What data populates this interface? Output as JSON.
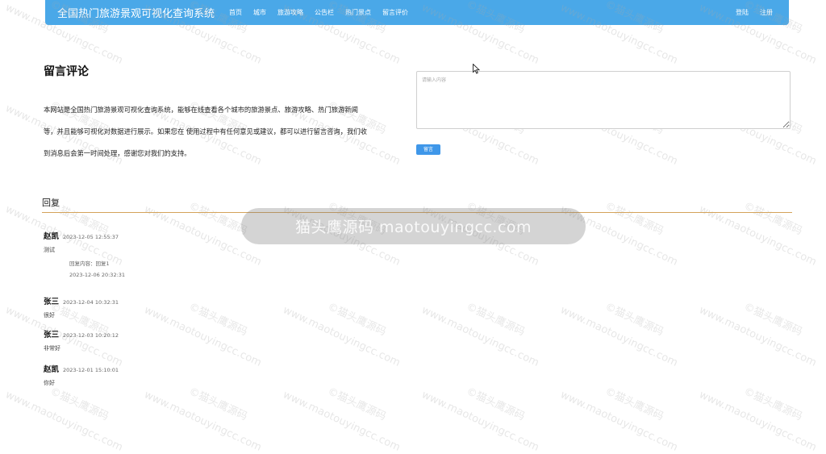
{
  "header": {
    "brand": "全国热门旅游景观可视化查询系统",
    "nav": [
      "首页",
      "城市",
      "旅游攻略",
      "公告栏",
      "热门景点",
      "留言评价"
    ],
    "login": "登陆",
    "register": "注册"
  },
  "intro": {
    "title": "留言评论",
    "text": "本网站是全国热门旅游景观可视化查询系统，能够在线查看各个城市的旅游景点、旅游攻略、热门旅游新闻等，并且能够可视化对数据进行展示。如果您在 使用过程中有任何意见或建议，都可以进行留言咨询，我们收到消息后会第一时间处理，感谢您对我们的支持。"
  },
  "form": {
    "placeholder": "请输入内容",
    "submit_label": "留言"
  },
  "replies": {
    "heading": "回复",
    "comments": [
      {
        "author": "赵凯",
        "time": "2023-12-05 12:55:37",
        "content": "测试",
        "reply_content": "回复内容：回复1",
        "reply_time": "2023-12-06 20:32:31"
      },
      {
        "author": "张三",
        "time": "2023-12-04 10:32:31",
        "content": "很好"
      },
      {
        "author": "张三",
        "time": "2023-12-03 10:20:12",
        "content": "非常好"
      },
      {
        "author": "赵凯",
        "time": "2023-12-01 15:10:01",
        "content": "你好"
      }
    ]
  },
  "watermark": {
    "site": "www.maotouyingcc.com",
    "brand": "©猫头鹰源码",
    "badge": "猫头鹰源码 maotouyingcc.com"
  },
  "colors": {
    "navbar": "#4aa8e8",
    "button": "#3f97e9",
    "divider": "#d4a35a"
  }
}
